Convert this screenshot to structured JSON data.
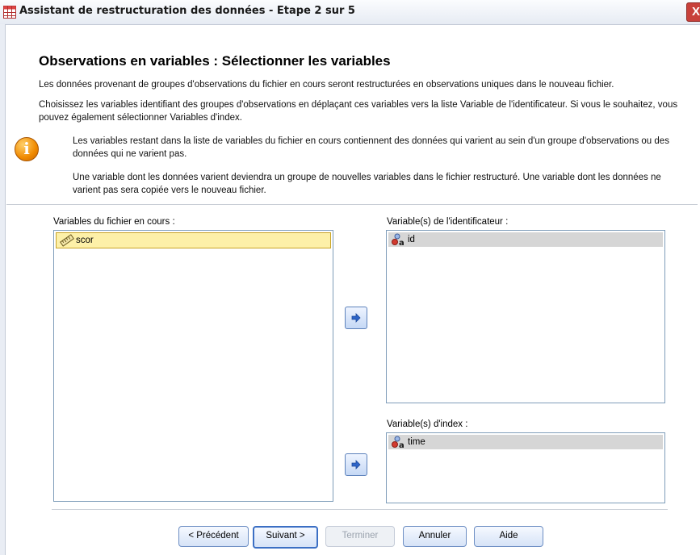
{
  "window": {
    "title": "Assistant de restructuration des données - Etape 2 sur 5",
    "close_label": "X"
  },
  "main": {
    "heading": "Observations en variables : Sélectionner les variables",
    "intro": "Les données provenant de groupes d'observations du fichier en cours seront restructurées en observations uniques dans le nouveau fichier.",
    "instructions": "Choisissez les variables identifiant des groupes d'observations en déplaçant ces variables vers la liste Variable de l'identificateur. Si vous le souhaitez, vous pouvez également sélectionner Variables d'index.",
    "info_1": "Les variables restant dans la liste de variables du fichier en cours contiennent des données qui varient au sein d'un groupe d'observations ou des données qui ne varient pas.",
    "info_2": "Une variable dont les données varient deviendra un groupe de nouvelles variables dans le fichier restructuré. Une variable dont les données ne varient pas sera copiée vers le nouveau fichier."
  },
  "current_vars": {
    "label": "Variables du fichier en cours :",
    "items": [
      {
        "name": "scor",
        "icon": "ruler-scale-icon"
      }
    ]
  },
  "id_vars": {
    "label": "Variable(s) de l'identificateur :",
    "items": [
      {
        "name": "id",
        "icon": "nominal-string-icon"
      }
    ]
  },
  "index_vars": {
    "label": "Variable(s) d'index :",
    "items": [
      {
        "name": "time",
        "icon": "nominal-string-icon"
      }
    ]
  },
  "buttons": {
    "previous": "< Précédent",
    "next": "Suivant >",
    "finish": "Terminer",
    "cancel": "Annuler",
    "help": "Aide"
  },
  "colors": {
    "selected_bg": "#fdf0a8",
    "grey_item_bg": "#d6d6d6",
    "button_border": "#6e8fc4"
  }
}
